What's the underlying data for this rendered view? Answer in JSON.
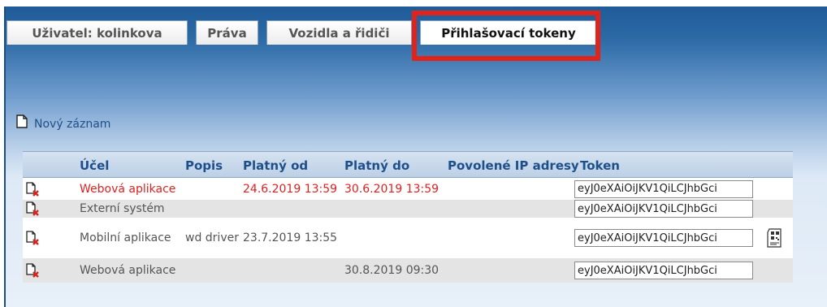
{
  "tabs": [
    {
      "label": "Uživatel: kolinkova"
    },
    {
      "label": "Práva"
    },
    {
      "label": "Vozidla a řidiči"
    },
    {
      "label": "Přihlašovací tokeny",
      "active": true
    }
  ],
  "new_record": {
    "label": "Nový záznam",
    "icon": "new-document-icon"
  },
  "table": {
    "columns": [
      "Účel",
      "Popis",
      "Platný od",
      "Platný do",
      "Povolené IP adresy",
      "Token"
    ],
    "rows": [
      {
        "ucel": "Webová aplikace",
        "popis": "",
        "platny_od": "24.6.2019 13:59",
        "platny_do": "30.6.2019 13:59",
        "ip": "",
        "token": "eyJ0eXAiOiJKV1QiLCJhbGci",
        "expired": true
      },
      {
        "ucel": "Externí systém",
        "popis": "",
        "platny_od": "",
        "platny_do": "",
        "ip": "",
        "token": "eyJ0eXAiOiJKV1QiLCJhbGci"
      },
      {
        "ucel": "Mobilní aplikace",
        "popis": "wd driver",
        "platny_od": "23.7.2019 13:55",
        "platny_do": "",
        "ip": "",
        "token": "eyJ0eXAiOiJKV1QiLCJhbGci",
        "qr": true
      },
      {
        "ucel": "Webová aplikace",
        "popis": "",
        "platny_od": "",
        "platny_do": "30.8.2019 09:30",
        "ip": "",
        "token": "eyJ0eXAiOiJKV1QiLCJhbGci"
      }
    ]
  },
  "colors": {
    "expired": "#e01f1f",
    "header_text": "#1f4f8a",
    "highlight": "#e0241b"
  },
  "icons": {
    "delete": "delete-record-icon",
    "qr": "qr-code-icon"
  }
}
